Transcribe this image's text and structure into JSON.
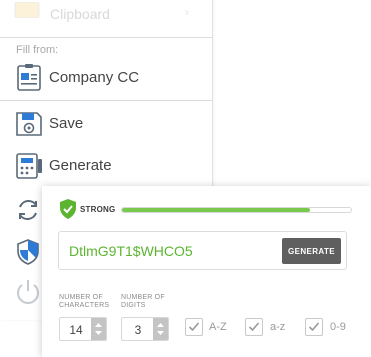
{
  "menu": {
    "faded_row_label": "Clipboard",
    "fill_from_label": "Fill from:",
    "fill_from_item": "Company CC",
    "save_label": "Save",
    "generate_label": "Generate"
  },
  "generator": {
    "strength_label": "STRONG",
    "strength_fraction": 0.82,
    "strength_color": "#7ac94e",
    "password": "DtlmG9T1$WHCO5",
    "password_color": "#5cb531",
    "generate_button_label": "GENERATE",
    "num_characters_label": "NUMBER OF CHARACTERS",
    "num_characters_value": "14",
    "num_digits_label": "NUMBER OF DIGITS",
    "num_digits_value": "3",
    "options": [
      {
        "label": "A-Z",
        "checked": true
      },
      {
        "label": "a-z",
        "checked": true
      },
      {
        "label": "0-9",
        "checked": true
      }
    ]
  },
  "icons": {
    "faded_row": "clipboard-icon",
    "company_card": "card-icon",
    "save": "floppy-disk-icon",
    "generate": "password-generator-icon",
    "sync": "sync-icon",
    "security": "shield-icon",
    "power": "power-icon",
    "strength": "shield-check-icon"
  }
}
